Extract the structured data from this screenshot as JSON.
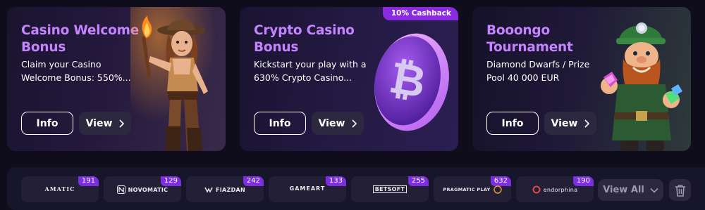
{
  "promos": [
    {
      "title_line1": "Casino Welcome",
      "title_line2": "Bonus",
      "desc_line1": "Claim your Casino",
      "desc_line2": "Welcome Bonus: 550%...",
      "info_label": "Info",
      "view_label": "View",
      "art": "adventurer-with-torch-illustration"
    },
    {
      "title_line1": "Crypto Casino",
      "title_line2": "Bonus",
      "desc_line1": "Kickstart your play with a",
      "desc_line2": "630% Crypto Casino...",
      "info_label": "Info",
      "view_label": "View",
      "badge": "10% Cashback",
      "art": "bitcoin-coin-illustration"
    },
    {
      "title_line1": "Booongo",
      "title_line2": "Tournament",
      "desc_line1": "Diamond Dwarfs / Prize",
      "desc_line2": "Pool 40 000 EUR",
      "info_label": "Info",
      "view_label": "View",
      "art": "dwarf-with-gems-illustration"
    }
  ],
  "providers": [
    {
      "name": "AMATIC",
      "count": "191"
    },
    {
      "name": "NOVOMATIC",
      "count": "129"
    },
    {
      "name": "FIAZDAN",
      "count": "242"
    },
    {
      "name": "GAMEART",
      "count": "133"
    },
    {
      "name": "BETSOFT",
      "count": "255"
    },
    {
      "name": "PRAGMATIC PLAY",
      "count": "632"
    },
    {
      "name": "endorphina",
      "count": "190"
    }
  ],
  "view_all_label": "View All",
  "colors": {
    "background": "#0f0d1c",
    "accent_purple": "#c583ff",
    "badge_purple": "#7d2fe0",
    "button_dark": "#2c2840",
    "tile": "#221f36"
  },
  "icons": [
    "chevron-right-icon",
    "chevron-down-icon",
    "trash-icon",
    "bitcoin-icon"
  ]
}
